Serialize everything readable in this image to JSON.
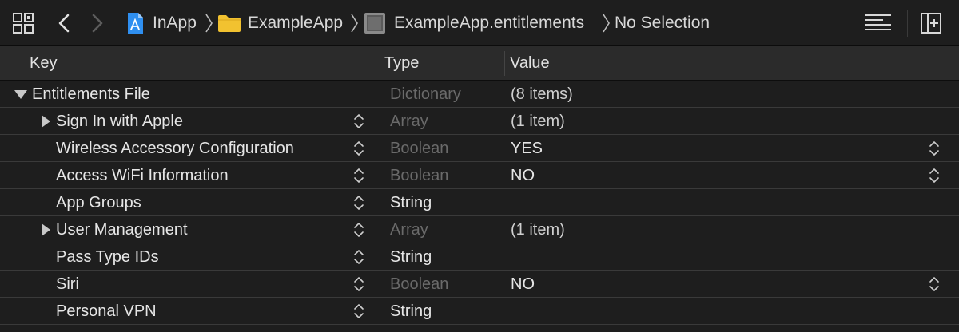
{
  "breadcrumb": {
    "items": [
      {
        "label": "InApp",
        "icon": "project-file-icon"
      },
      {
        "label": "ExampleApp",
        "icon": "folder-icon"
      },
      {
        "label": "ExampleApp.entitlements",
        "icon": "entitlements-file-icon"
      },
      {
        "label": "No Selection",
        "icon": ""
      }
    ]
  },
  "toolbar": {
    "related_items_icon": "grid-icon",
    "back_icon": "chevron-left-icon",
    "forward_icon": "chevron-right-icon",
    "minimap_icon": "lines-icon",
    "add_editor_icon": "add-editor-icon"
  },
  "table": {
    "columns": {
      "key": "Key",
      "type": "Type",
      "value": "Value"
    },
    "rows": [
      {
        "key": "Entitlements File",
        "type": "Dictionary",
        "value": "(8 items)",
        "expanded": true,
        "type_dim": true
      },
      {
        "key": "Sign In with Apple",
        "type": "Array",
        "value": "(1 item)",
        "expanded": false,
        "type_dim": true
      },
      {
        "key": "Wireless Accessory Configuration",
        "type": "Boolean",
        "value": "YES",
        "type_dim": true
      },
      {
        "key": "Access WiFi Information",
        "type": "Boolean",
        "value": "NO",
        "type_dim": true
      },
      {
        "key": "App Groups",
        "type": "String",
        "value": "",
        "type_dim": false
      },
      {
        "key": "User Management",
        "type": "Array",
        "value": "(1 item)",
        "expanded": false,
        "type_dim": true
      },
      {
        "key": "Pass Type IDs",
        "type": "String",
        "value": "",
        "type_dim": false
      },
      {
        "key": "Siri",
        "type": "Boolean",
        "value": "NO",
        "type_dim": true
      },
      {
        "key": "Personal VPN",
        "type": "String",
        "value": "",
        "type_dim": false
      }
    ]
  },
  "colors": {
    "background": "#1e1e1e",
    "header": "#2b2b2b",
    "folder": "#f2c230",
    "project_icon": "#2f8ff0"
  }
}
